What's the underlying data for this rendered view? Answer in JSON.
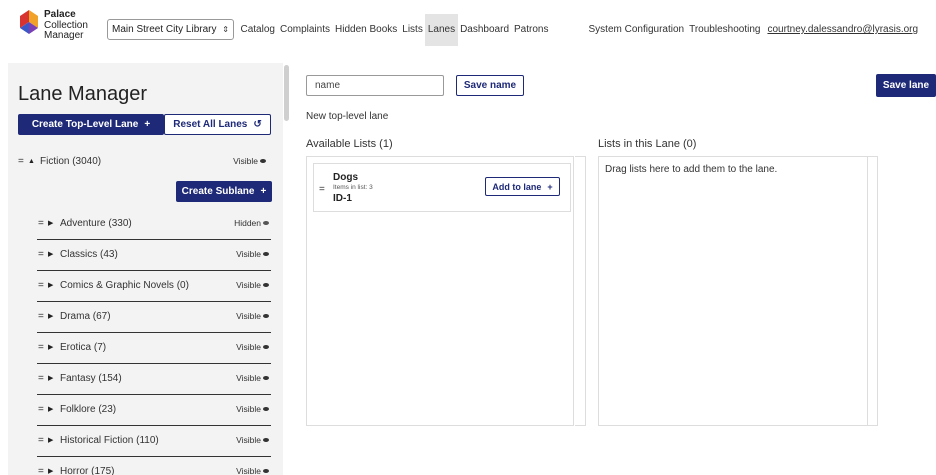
{
  "header": {
    "logo_lines": [
      "Palace",
      "Collection",
      "Manager"
    ],
    "library_select": "Main Street City Library",
    "nav": [
      "Catalog",
      "Complaints",
      "Hidden Books",
      "Lists",
      "Lanes",
      "Dashboard",
      "Patrons"
    ],
    "active_nav": "Lanes",
    "nav_right": [
      "System Configuration",
      "Troubleshooting"
    ],
    "user_email": "courtney.dalessandro@lyrasis.org"
  },
  "sidebar": {
    "title": "Lane Manager",
    "create_top_label": "Create Top-Level Lane",
    "reset_label": "Reset All Lanes",
    "top_lane": {
      "name": "Fiction (3040)",
      "visibility": "Visible"
    },
    "create_sub_label": "Create Sublane",
    "sublanes": [
      {
        "name": "Adventure (330)",
        "visibility": "Hidden"
      },
      {
        "name": "Classics (43)",
        "visibility": "Visible"
      },
      {
        "name": "Comics & Graphic Novels (0)",
        "visibility": "Visible"
      },
      {
        "name": "Drama (67)",
        "visibility": "Visible"
      },
      {
        "name": "Erotica (7)",
        "visibility": "Visible"
      },
      {
        "name": "Fantasy (154)",
        "visibility": "Visible"
      },
      {
        "name": "Folklore (23)",
        "visibility": "Visible"
      },
      {
        "name": "Historical Fiction (110)",
        "visibility": "Visible"
      },
      {
        "name": "Horror (175)",
        "visibility": "Visible"
      }
    ]
  },
  "editor": {
    "name_value": "name",
    "save_name_label": "Save name",
    "save_lane_label": "Save lane",
    "subtitle": "New top-level lane",
    "available_heading": "Available Lists (1)",
    "lane_heading": "Lists in this Lane (0)",
    "drop_hint": "Drag lists here to add them to the lane.",
    "lists": [
      {
        "name": "Dogs",
        "items": "Items in list: 3",
        "id": "ID-1",
        "add_label": "Add to lane"
      }
    ]
  },
  "colors": {
    "primary": "#1e2a78",
    "sidebar_bg": "#f3f3f3",
    "active_nav_bg": "#e4e4e4"
  }
}
